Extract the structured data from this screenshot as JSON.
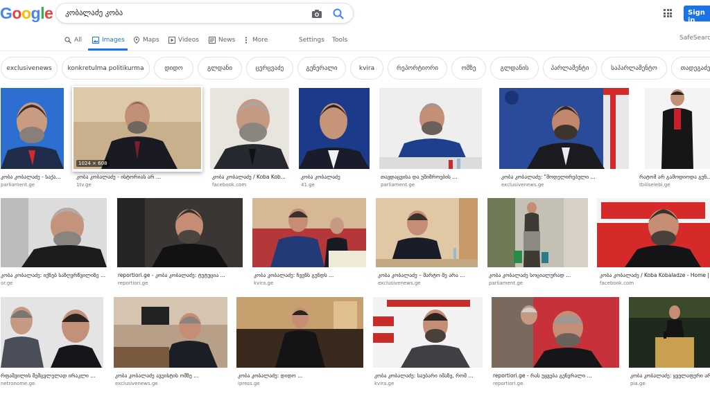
{
  "header": {
    "logo_letters": [
      "G",
      "o",
      "o",
      "g",
      "l",
      "e"
    ],
    "query": "კობალაძე კობა",
    "signin_label": "Sign in"
  },
  "tabs": [
    {
      "label": "All",
      "icon": "search-icon"
    },
    {
      "label": "Images",
      "icon": "image-icon",
      "active": true
    },
    {
      "label": "Maps",
      "icon": "map-pin-icon"
    },
    {
      "label": "Videos",
      "icon": "play-icon"
    },
    {
      "label": "News",
      "icon": "news-icon"
    },
    {
      "label": "More",
      "icon": "more-icon"
    },
    {
      "label": "Settings"
    },
    {
      "label": "Tools"
    }
  ],
  "safesearch": "SafeSearch",
  "chips": [
    "exclusivenews",
    "konkretulma politikurma",
    "დიდო",
    "გლდანი",
    "ცერცვაძე",
    "გენერალი",
    "kvira",
    "რეპორტიორი",
    "ომზე",
    "გლდანის",
    "პარლამენტი",
    "საპარლამენტო",
    "თადეგაძე"
  ],
  "results": [
    {
      "caption": "კობა კობალაძე - საქა...",
      "source": "parliament.ge"
    },
    {
      "caption": "კობა კობალაძე - ისტორიას არ ...",
      "source": "1tv.ge",
      "dimensions": "1024 × 608"
    },
    {
      "caption": "კობა კობალაძე / Koba Kob...",
      "source": "facebook.com"
    },
    {
      "caption": "კობა კობალაძე",
      "source": "41.ge"
    },
    {
      "caption": "თავდაცვისა და უშიშროების ...",
      "source": "parliament.ge"
    },
    {
      "caption": "კობა კობალაძე: \"მოდელირებული ...",
      "source": "exclusivenews.ge"
    },
    {
      "caption": "რატომ არ გამოდიოდა გენ...",
      "source": "tbiliselebi.ge"
    },
    {
      "caption": "კობა კობალაძე: იქნებ საზღვრწვილიზე ...",
      "source": "or.ge"
    },
    {
      "caption": "reportiori.ge - კობა კობალაძე: ტუტუცია ...",
      "source": "reportiori.ge"
    },
    {
      "caption": "კობა კობალაძე: ჩვენს გუნდს ...",
      "source": "kvira.ge"
    },
    {
      "caption": "კობა კობალაძე – მარტო მე არა ...",
      "source": "exclusivenews.ge"
    },
    {
      "caption": "კობა კობალაძე სოციალურად ...",
      "source": "parliament.ge"
    },
    {
      "caption": "კობა კობალაძე / Koba Kobaladze - Home |",
      "source": "facebook.com"
    },
    {
      "caption": "რფაშვილის შემცვლელად ირაკლი ...",
      "source": "netronome.ge"
    },
    {
      "caption": "კობა კობალაძე ავეისტის ომზე ...",
      "source": "exclusivenews.ge"
    },
    {
      "caption": "კობა კობალაძე: დიდო ...",
      "source": "ipress.ge"
    },
    {
      "caption": "კობა კობალაძე: საუბარი იმაზე, რომ ...",
      "source": "kvira.ge"
    },
    {
      "caption": "reportiori.ge - რას უყვება გენერალი ...",
      "source": "reportiori.ge"
    },
    {
      "caption": "კობა კობალაძე: ყველაფერი არ ...",
      "source": "pia.ge"
    }
  ],
  "colors": {
    "accent": "#1a73e8",
    "logo": [
      "#4285f4",
      "#ea4335",
      "#fbbc05",
      "#4285f4",
      "#34a853",
      "#ea4335"
    ]
  }
}
